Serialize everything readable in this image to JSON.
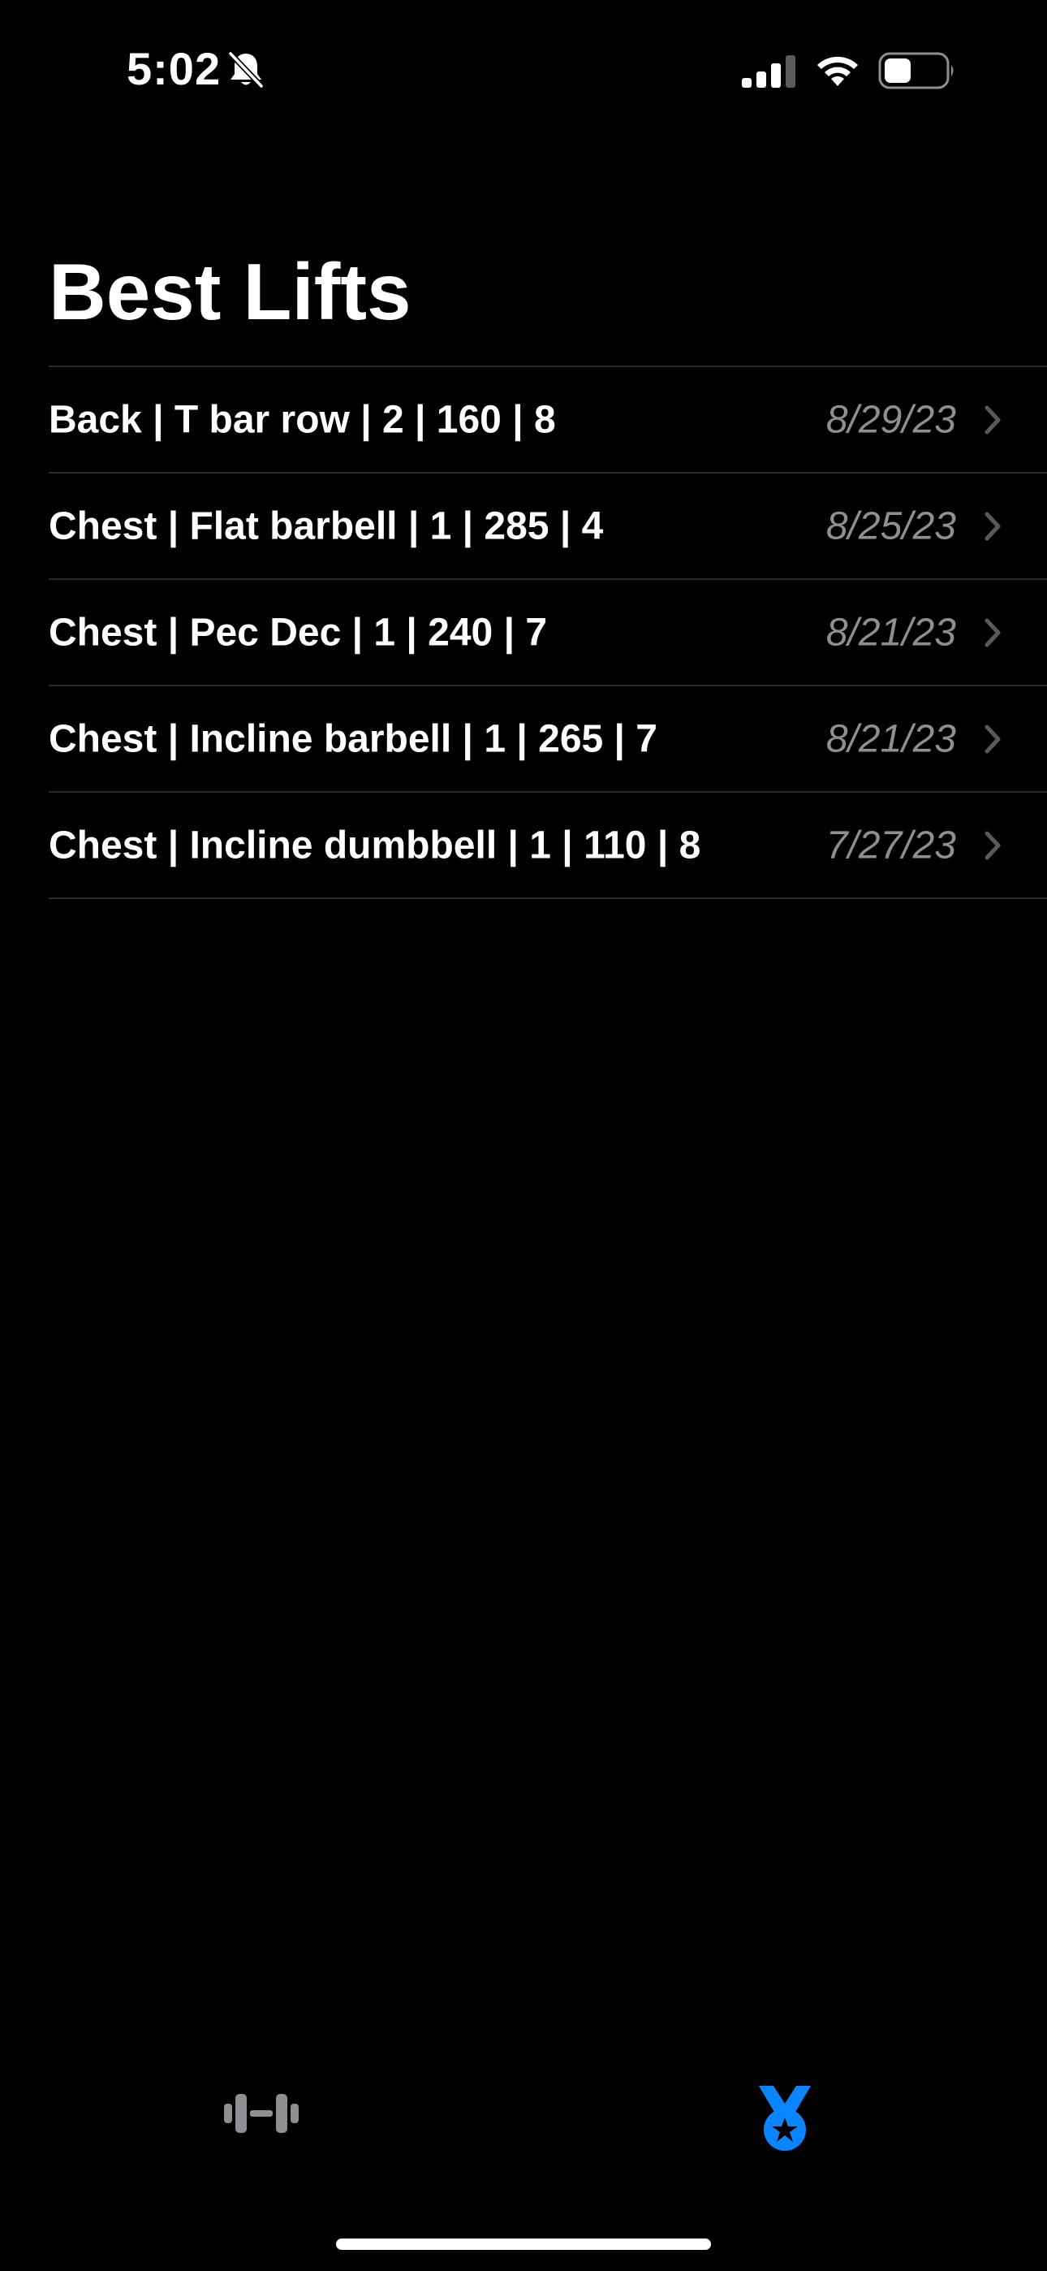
{
  "status_bar": {
    "time": "5:02",
    "silent_mode": true,
    "battery_level": 0.45
  },
  "header": {
    "title": "Best Lifts"
  },
  "lifts": [
    {
      "label": "Back | T bar row | 2 | 160 | 8",
      "date": "8/29/23"
    },
    {
      "label": "Chest | Flat barbell | 1 | 285 | 4",
      "date": "8/25/23"
    },
    {
      "label": "Chest | Pec Dec | 1 | 240 | 7",
      "date": "8/21/23"
    },
    {
      "label": "Chest | Incline barbell | 1 | 265 | 7",
      "date": "8/21/23"
    },
    {
      "label": "Chest | Incline dumbbell | 1 | 110 | 8",
      "date": "7/27/23"
    }
  ],
  "tab_bar": {
    "tabs": [
      {
        "icon": "dumbbell-icon",
        "selected": false
      },
      {
        "icon": "medal-icon",
        "selected": true
      }
    ]
  },
  "colors": {
    "background": "#000000",
    "text_primary": "#ffffff",
    "text_secondary": "#8e8e93",
    "separator": "#2b2b2e",
    "accent": "#0a84ff",
    "tab_inactive": "#8e8e93"
  }
}
